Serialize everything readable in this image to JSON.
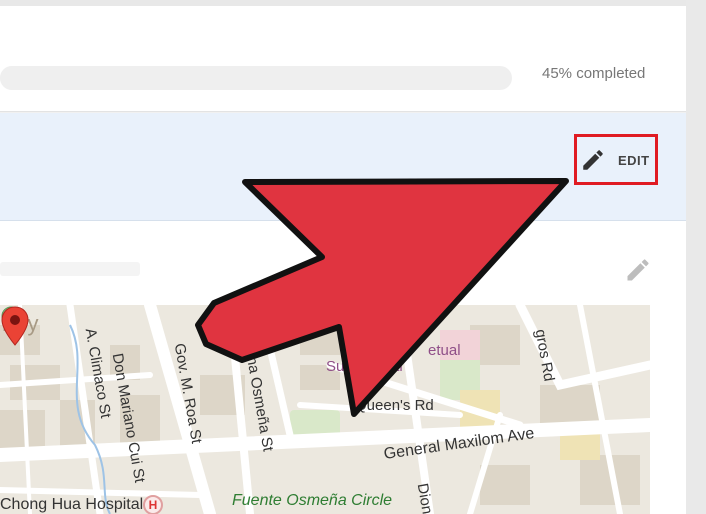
{
  "progress": {
    "label": "45% completed",
    "value_percent": 45
  },
  "edit_section": {
    "edit_label": "EDIT",
    "edit_icon": "pencil-icon",
    "highlight_color": "#e01b22"
  },
  "map_section": {
    "edit_icon": "pencil-icon",
    "labels": {
      "district": "rty",
      "climaco": "A. Climaco St",
      "don_mariano": "Don Mariano Cui St",
      "gov_roa": "Gov. M. Roa St",
      "osmena": "ena Osmeña St",
      "su_hospital": "Su      Hospital",
      "tetual": "etual",
      "queens": "Queen's Rd",
      "gorordo": "gros Rd",
      "maxilom": "General Maxilom Ave",
      "dion": "Dion",
      "chong_hua": "Chong Hua Hospital",
      "hospital_marker": "H",
      "fuente": "Fuente Osmeña Circle"
    }
  },
  "overlay": {
    "arrow_color": "#e03440",
    "arrow_outline": "#111111"
  }
}
